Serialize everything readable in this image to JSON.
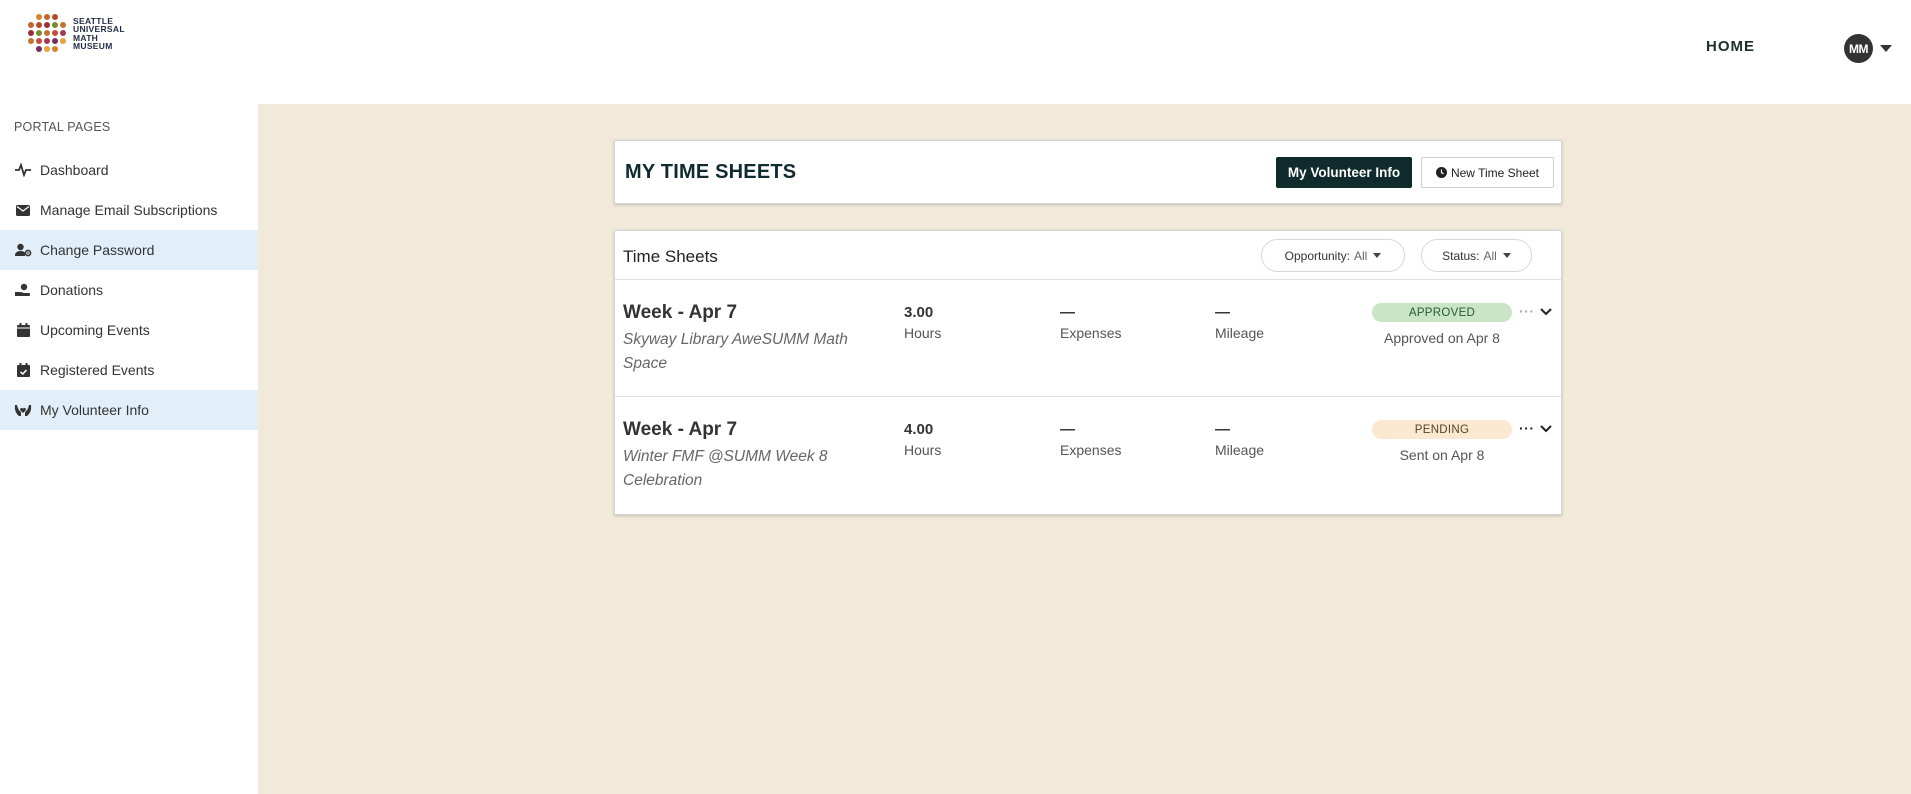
{
  "brand": {
    "logo_lines": [
      "SEATTLE",
      "UNIVERSAL",
      "MATH",
      "MUSEUM"
    ],
    "dot_colors": [
      "#e8a33d",
      "#d8822f",
      "#c9632a",
      "#b64a2c",
      "#9a2f3c",
      "#7a8a2c",
      "#c4732e",
      "#c84a3a",
      "#a83852",
      "#7a2c5a"
    ]
  },
  "topnav": {
    "home_label": "HOME",
    "avatar_initials": "MM"
  },
  "sidebar": {
    "heading": "PORTAL PAGES",
    "items": [
      {
        "label": "Dashboard",
        "icon": "pulse-icon",
        "active": false
      },
      {
        "label": "Manage Email Subscriptions",
        "icon": "envelope-icon",
        "active": false
      },
      {
        "label": "Change Password",
        "icon": "user-gear-icon",
        "active": true
      },
      {
        "label": "Donations",
        "icon": "hand-holding-icon",
        "active": false
      },
      {
        "label": "Upcoming Events",
        "icon": "calendar-icon",
        "active": false
      },
      {
        "label": "Registered Events",
        "icon": "calendar-check-icon",
        "active": false
      },
      {
        "label": "My Volunteer Info",
        "icon": "hands-heart-icon",
        "active": true
      }
    ]
  },
  "header_card": {
    "title": "MY TIME SHEETS",
    "volunteer_button": "My Volunteer Info",
    "new_sheet_button": "New Time Sheet"
  },
  "sheets": {
    "title": "Time Sheets",
    "filters": {
      "opportunity_label": "Opportunity:",
      "opportunity_value": "All",
      "status_label": "Status:",
      "status_value": "All"
    },
    "column_labels": {
      "hours": "Hours",
      "expenses": "Expenses",
      "mileage": "Mileage"
    },
    "rows": [
      {
        "week": "Week - Apr 7",
        "opportunity": "Skyway Library AweSUMM Math Space",
        "hours": "3.00",
        "expenses": "—",
        "mileage": "—",
        "status": "APPROVED",
        "status_note": "Approved on Apr 8"
      },
      {
        "week": "Week - Apr 7",
        "opportunity": "Winter FMF @SUMM Week 8 Celebration",
        "hours": "4.00",
        "expenses": "—",
        "mileage": "—",
        "status": "PENDING",
        "status_note": "Sent on Apr 8"
      }
    ]
  },
  "colors": {
    "main_bg": "#f1eada",
    "primary_button": "#0f2b2b",
    "active_nav": "#e2eff9",
    "approved_badge": "#c9e5c6",
    "pending_badge": "#fbe8d0"
  }
}
